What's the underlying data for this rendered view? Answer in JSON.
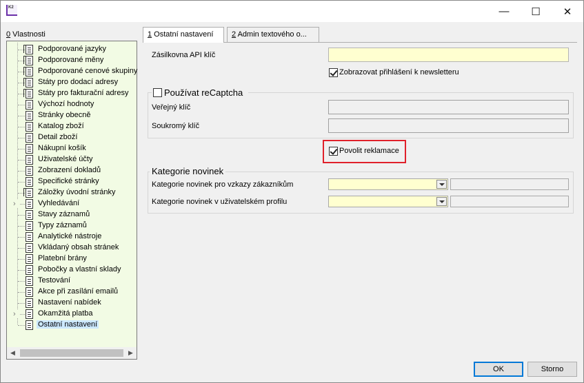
{
  "window": {
    "title": "K2",
    "buttons": {
      "minimize": "—",
      "maximize": "☐",
      "close": "✕"
    }
  },
  "left_panel": {
    "title_prefix": "0",
    "title_rest": " Vlastnosti",
    "tree_items": [
      {
        "label": "Podporované jazyky",
        "icon": "stack-doc-icon",
        "expandable": false
      },
      {
        "label": "Podporované měny",
        "icon": "stack-doc-icon",
        "expandable": false
      },
      {
        "label": "Podporované cenové skupiny",
        "icon": "stack-doc-icon",
        "expandable": false
      },
      {
        "label": "Státy pro dodací adresy",
        "icon": "stack-doc-icon",
        "expandable": false
      },
      {
        "label": "Státy pro fakturační adresy",
        "icon": "stack-doc-icon",
        "expandable": false
      },
      {
        "label": "Výchozí hodnoty",
        "icon": "doc-icon",
        "expandable": false
      },
      {
        "label": "Stránky obecně",
        "icon": "doc-icon",
        "expandable": false
      },
      {
        "label": "Katalog zboží",
        "icon": "doc-icon",
        "expandable": false
      },
      {
        "label": "Detail zboží",
        "icon": "doc-icon",
        "expandable": false
      },
      {
        "label": "Nákupní košík",
        "icon": "doc-icon",
        "expandable": false
      },
      {
        "label": "Uživatelské účty",
        "icon": "doc-icon",
        "expandable": false
      },
      {
        "label": "Zobrazení dokladů",
        "icon": "doc-icon",
        "expandable": false
      },
      {
        "label": "Specifické stránky",
        "icon": "doc-icon",
        "expandable": false
      },
      {
        "label": "Záložky úvodní stránky",
        "icon": "stack-doc-icon",
        "expandable": false
      },
      {
        "label": "Vyhledávání",
        "icon": "doc-icon",
        "expandable": true
      },
      {
        "label": "Stavy záznamů",
        "icon": "doc-icon",
        "expandable": false
      },
      {
        "label": "Typy záznamů",
        "icon": "doc-icon",
        "expandable": false
      },
      {
        "label": "Analytické nástroje",
        "icon": "doc-icon",
        "expandable": false
      },
      {
        "label": "Vkládaný obsah stránek",
        "icon": "doc-icon",
        "expandable": false
      },
      {
        "label": "Platební brány",
        "icon": "doc-icon",
        "expandable": false
      },
      {
        "label": "Pobočky a vlastní sklady",
        "icon": "doc-icon",
        "expandable": false
      },
      {
        "label": "Testování",
        "icon": "doc-icon",
        "expandable": false
      },
      {
        "label": "Akce při zasílání emailů",
        "icon": "doc-icon",
        "expandable": false
      },
      {
        "label": "Nastavení nabídek",
        "icon": "doc-icon",
        "expandable": false
      },
      {
        "label": "Okamžitá platba",
        "icon": "doc-icon",
        "expandable": true
      },
      {
        "label": "Ostatní nastavení",
        "icon": "doc-icon",
        "expandable": false,
        "selected": true
      }
    ]
  },
  "tabs": [
    {
      "prefix": "1",
      "rest": " Ostatní nastavení",
      "active": true
    },
    {
      "prefix": "2",
      "rest": " Admin textového o...",
      "active": false
    }
  ],
  "form": {
    "zasilkovna_label": "Zásilkovna API klíč",
    "zasilkovna_value": "",
    "newsletter_label": "Zobrazovat přihlášení k newsletteru",
    "newsletter_checked": true,
    "recaptcha_label": "Používat reCaptcha",
    "recaptcha_checked": false,
    "public_key_label": "Veřejný klíč",
    "public_key_value": "",
    "private_key_label": "Soukromý klíč",
    "private_key_value": "",
    "complaints_label": "Povolit reklamace",
    "complaints_checked": true,
    "news_group_title": "Kategorie novinek",
    "news_show_label": "Kategorie novinek pro vzkazy zákazníkům",
    "news_show_value": "",
    "news_profile_label": "Kategorie novinek v uživatelském profilu",
    "news_profile_value": ""
  },
  "buttons": {
    "ok": "OK",
    "storno": "Storno"
  },
  "colors": {
    "tree_bg": "#f2fbe4",
    "input_yellow": "#ffffd0",
    "highlight": "#e0202a",
    "selected": "#cce8ff"
  }
}
